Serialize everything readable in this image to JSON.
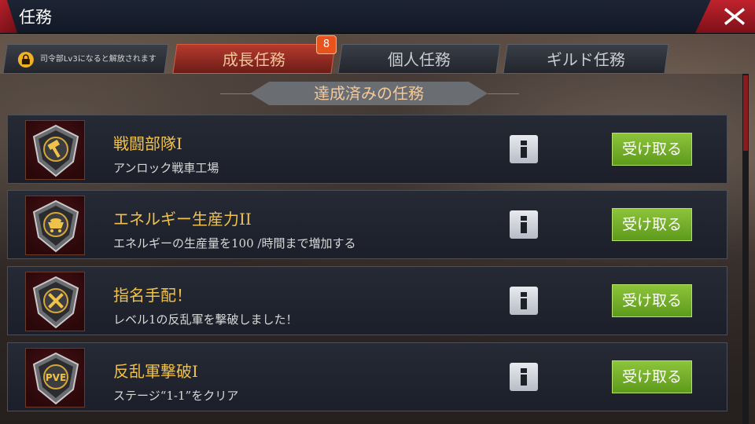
{
  "window": {
    "title": "任務"
  },
  "tabs": {
    "locked_label": "司令部Lv3になると解放されます",
    "items": [
      {
        "label": "成長任務",
        "active": true,
        "badge": "8"
      },
      {
        "label": "個人任務",
        "active": false
      },
      {
        "label": "ギルド任務",
        "active": false
      }
    ]
  },
  "section": {
    "title": "達成済みの任務"
  },
  "missions": [
    {
      "icon": "hammer-emblem-icon",
      "title": "戦闘部隊I",
      "desc": "アンロック戦車工場",
      "claim_label": "受け取る"
    },
    {
      "icon": "ore-cart-emblem-icon",
      "title": "エネルギー生産力II",
      "desc": "エネルギーの生産量を100 /時間まで増加する",
      "claim_label": "受け取る"
    },
    {
      "icon": "crossed-swords-emblem-icon",
      "title": "指名手配！",
      "desc": "レベル1の反乱軍を撃破しました！",
      "claim_label": "受け取る"
    },
    {
      "icon": "pve-emblem-icon",
      "title": "反乱軍撃破I",
      "desc": "ステージ“1-1”をクリア",
      "claim_label": "受け取る"
    }
  ],
  "colors": {
    "active_tab": "#b63a2e",
    "claim_button": "#7cb830",
    "mission_title": "#f0c24a",
    "close_button": "#c1232e",
    "badge": "#e8531d"
  }
}
